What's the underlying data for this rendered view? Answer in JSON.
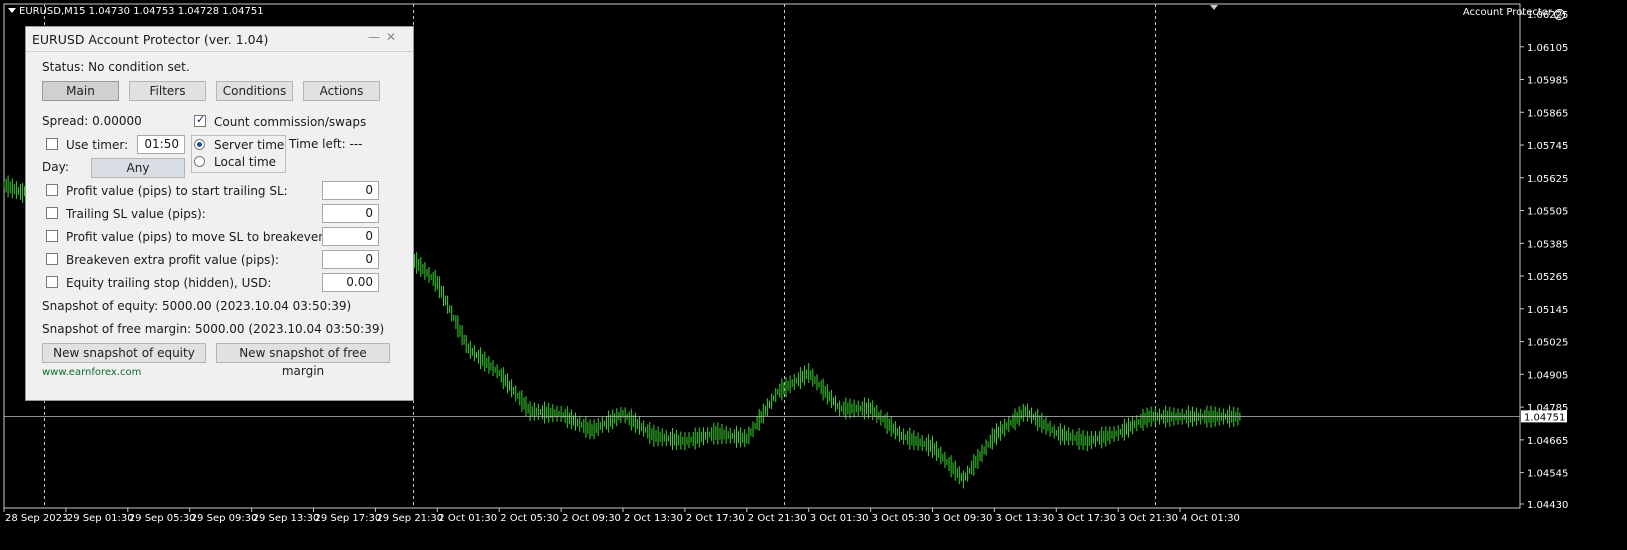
{
  "header": {
    "symbol_line": "EURUSD,M15  1.04730 1.04753 1.04728 1.04751",
    "ea_name": "Account Protector"
  },
  "panel": {
    "title": "EURUSD Account Protector (ver. 1.04)",
    "status": "Status: No condition set.",
    "tabs": [
      "Main",
      "Filters",
      "Conditions",
      "Actions"
    ],
    "spread_label": "Spread: 0.00000",
    "count_commission_label": "Count commission/swaps",
    "count_commission_checked": true,
    "use_timer_label": "Use timer:",
    "timer_value": "01:50",
    "server_time_label": "Server time",
    "local_time_label": "Local time",
    "time_left_label": "Time left: ---",
    "day_label": "Day:",
    "day_value": "Any",
    "rows": [
      {
        "label": "Profit value (pips) to start trailing SL:",
        "value": "0"
      },
      {
        "label": "Trailing SL value (pips):",
        "value": "0"
      },
      {
        "label": "Profit value (pips) to move SL to breakeven:",
        "value": "0"
      },
      {
        "label": "Breakeven extra profit value (pips):",
        "value": "0"
      },
      {
        "label": "Equity trailing stop (hidden), USD:",
        "value": "0.00"
      }
    ],
    "snapshot_equity": "Snapshot of equity: 5000.00 (2023.10.04 03:50:39)",
    "snapshot_margin": "Snapshot of free margin: 5000.00 (2023.10.04 03:50:39)",
    "btn_new_equity": "New snapshot of equity",
    "btn_new_margin": "New snapshot of free margin",
    "website": "www.earnforex.com"
  },
  "chart_data": {
    "type": "line",
    "symbol": "EURUSD",
    "timeframe": "M15",
    "current_price": "1.04751",
    "price_ticks": [
      "1.06225",
      "1.06105",
      "1.05985",
      "1.05865",
      "1.05745",
      "1.05625",
      "1.05505",
      "1.05385",
      "1.05265",
      "1.05145",
      "1.05025",
      "1.04905",
      "1.04785",
      "1.04665",
      "1.04545",
      "1.04430"
    ],
    "time_ticks": [
      "28 Sep 2023",
      "29 Sep 01:30",
      "29 Sep 05:30",
      "29 Sep 09:30",
      "29 Sep 13:30",
      "29 Sep 17:30",
      "29 Sep 21:30",
      "2 Oct 01:30",
      "2 Oct 05:30",
      "2 Oct 09:30",
      "2 Oct 13:30",
      "2 Oct 17:30",
      "2 Oct 21:30",
      "3 Oct 01:30",
      "3 Oct 05:30",
      "3 Oct 09:30",
      "3 Oct 13:30",
      "3 Oct 17:30",
      "3 Oct 21:30",
      "4 Oct 01:30"
    ],
    "ylim": [
      1.0443,
      1.06225
    ],
    "series": [
      {
        "x": [
          0,
          0.3,
          0.6,
          1,
          1.5,
          2,
          2.5,
          3,
          3.5,
          4,
          4.5,
          5,
          5.3,
          5.6,
          6,
          6.5,
          7,
          7.5,
          8,
          8.5,
          9,
          9.5,
          10,
          10.5,
          11,
          11.5,
          12,
          12.5,
          13,
          13.5,
          14,
          14.5,
          15,
          15.5,
          16,
          16.5,
          17,
          17.5,
          18,
          18.5,
          19,
          19.5,
          20
        ],
        "y": [
          1.056,
          1.0557,
          1.0562,
          1.0573,
          1.0566,
          1.056,
          1.0565,
          1.057,
          1.0571,
          1.0568,
          1.0566,
          1.0592,
          1.058,
          1.0555,
          1.0537,
          1.0535,
          1.0524,
          1.05,
          1.0491,
          1.0477,
          1.0476,
          1.047,
          1.0476,
          1.0468,
          1.0466,
          1.0469,
          1.0467,
          1.0484,
          1.0491,
          1.0478,
          1.0478,
          1.0468,
          1.0464,
          1.0452,
          1.0468,
          1.0477,
          1.0469,
          1.0466,
          1.0469,
          1.0475,
          1.0475,
          1.0475,
          1.0475
        ]
      }
    ],
    "grid": false
  }
}
